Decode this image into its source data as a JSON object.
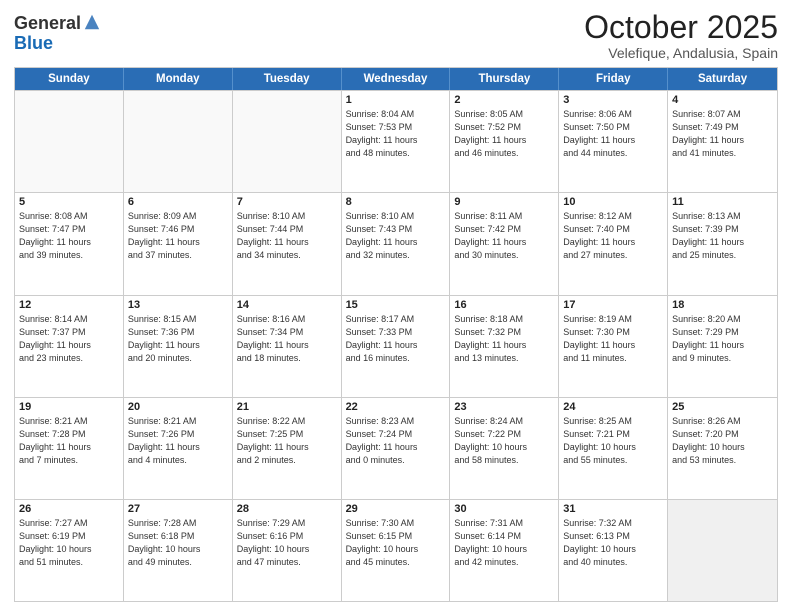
{
  "logo": {
    "general": "General",
    "blue": "Blue"
  },
  "header": {
    "month": "October 2025",
    "location": "Velefique, Andalusia, Spain"
  },
  "weekdays": [
    "Sunday",
    "Monday",
    "Tuesday",
    "Wednesday",
    "Thursday",
    "Friday",
    "Saturday"
  ],
  "weeks": [
    [
      {
        "day": "",
        "info": ""
      },
      {
        "day": "",
        "info": ""
      },
      {
        "day": "",
        "info": ""
      },
      {
        "day": "1",
        "info": "Sunrise: 8:04 AM\nSunset: 7:53 PM\nDaylight: 11 hours\nand 48 minutes."
      },
      {
        "day": "2",
        "info": "Sunrise: 8:05 AM\nSunset: 7:52 PM\nDaylight: 11 hours\nand 46 minutes."
      },
      {
        "day": "3",
        "info": "Sunrise: 8:06 AM\nSunset: 7:50 PM\nDaylight: 11 hours\nand 44 minutes."
      },
      {
        "day": "4",
        "info": "Sunrise: 8:07 AM\nSunset: 7:49 PM\nDaylight: 11 hours\nand 41 minutes."
      }
    ],
    [
      {
        "day": "5",
        "info": "Sunrise: 8:08 AM\nSunset: 7:47 PM\nDaylight: 11 hours\nand 39 minutes."
      },
      {
        "day": "6",
        "info": "Sunrise: 8:09 AM\nSunset: 7:46 PM\nDaylight: 11 hours\nand 37 minutes."
      },
      {
        "day": "7",
        "info": "Sunrise: 8:10 AM\nSunset: 7:44 PM\nDaylight: 11 hours\nand 34 minutes."
      },
      {
        "day": "8",
        "info": "Sunrise: 8:10 AM\nSunset: 7:43 PM\nDaylight: 11 hours\nand 32 minutes."
      },
      {
        "day": "9",
        "info": "Sunrise: 8:11 AM\nSunset: 7:42 PM\nDaylight: 11 hours\nand 30 minutes."
      },
      {
        "day": "10",
        "info": "Sunrise: 8:12 AM\nSunset: 7:40 PM\nDaylight: 11 hours\nand 27 minutes."
      },
      {
        "day": "11",
        "info": "Sunrise: 8:13 AM\nSunset: 7:39 PM\nDaylight: 11 hours\nand 25 minutes."
      }
    ],
    [
      {
        "day": "12",
        "info": "Sunrise: 8:14 AM\nSunset: 7:37 PM\nDaylight: 11 hours\nand 23 minutes."
      },
      {
        "day": "13",
        "info": "Sunrise: 8:15 AM\nSunset: 7:36 PM\nDaylight: 11 hours\nand 20 minutes."
      },
      {
        "day": "14",
        "info": "Sunrise: 8:16 AM\nSunset: 7:34 PM\nDaylight: 11 hours\nand 18 minutes."
      },
      {
        "day": "15",
        "info": "Sunrise: 8:17 AM\nSunset: 7:33 PM\nDaylight: 11 hours\nand 16 minutes."
      },
      {
        "day": "16",
        "info": "Sunrise: 8:18 AM\nSunset: 7:32 PM\nDaylight: 11 hours\nand 13 minutes."
      },
      {
        "day": "17",
        "info": "Sunrise: 8:19 AM\nSunset: 7:30 PM\nDaylight: 11 hours\nand 11 minutes."
      },
      {
        "day": "18",
        "info": "Sunrise: 8:20 AM\nSunset: 7:29 PM\nDaylight: 11 hours\nand 9 minutes."
      }
    ],
    [
      {
        "day": "19",
        "info": "Sunrise: 8:21 AM\nSunset: 7:28 PM\nDaylight: 11 hours\nand 7 minutes."
      },
      {
        "day": "20",
        "info": "Sunrise: 8:21 AM\nSunset: 7:26 PM\nDaylight: 11 hours\nand 4 minutes."
      },
      {
        "day": "21",
        "info": "Sunrise: 8:22 AM\nSunset: 7:25 PM\nDaylight: 11 hours\nand 2 minutes."
      },
      {
        "day": "22",
        "info": "Sunrise: 8:23 AM\nSunset: 7:24 PM\nDaylight: 11 hours\nand 0 minutes."
      },
      {
        "day": "23",
        "info": "Sunrise: 8:24 AM\nSunset: 7:22 PM\nDaylight: 10 hours\nand 58 minutes."
      },
      {
        "day": "24",
        "info": "Sunrise: 8:25 AM\nSunset: 7:21 PM\nDaylight: 10 hours\nand 55 minutes."
      },
      {
        "day": "25",
        "info": "Sunrise: 8:26 AM\nSunset: 7:20 PM\nDaylight: 10 hours\nand 53 minutes."
      }
    ],
    [
      {
        "day": "26",
        "info": "Sunrise: 7:27 AM\nSunset: 6:19 PM\nDaylight: 10 hours\nand 51 minutes."
      },
      {
        "day": "27",
        "info": "Sunrise: 7:28 AM\nSunset: 6:18 PM\nDaylight: 10 hours\nand 49 minutes."
      },
      {
        "day": "28",
        "info": "Sunrise: 7:29 AM\nSunset: 6:16 PM\nDaylight: 10 hours\nand 47 minutes."
      },
      {
        "day": "29",
        "info": "Sunrise: 7:30 AM\nSunset: 6:15 PM\nDaylight: 10 hours\nand 45 minutes."
      },
      {
        "day": "30",
        "info": "Sunrise: 7:31 AM\nSunset: 6:14 PM\nDaylight: 10 hours\nand 42 minutes."
      },
      {
        "day": "31",
        "info": "Sunrise: 7:32 AM\nSunset: 6:13 PM\nDaylight: 10 hours\nand 40 minutes."
      },
      {
        "day": "",
        "info": ""
      }
    ]
  ]
}
